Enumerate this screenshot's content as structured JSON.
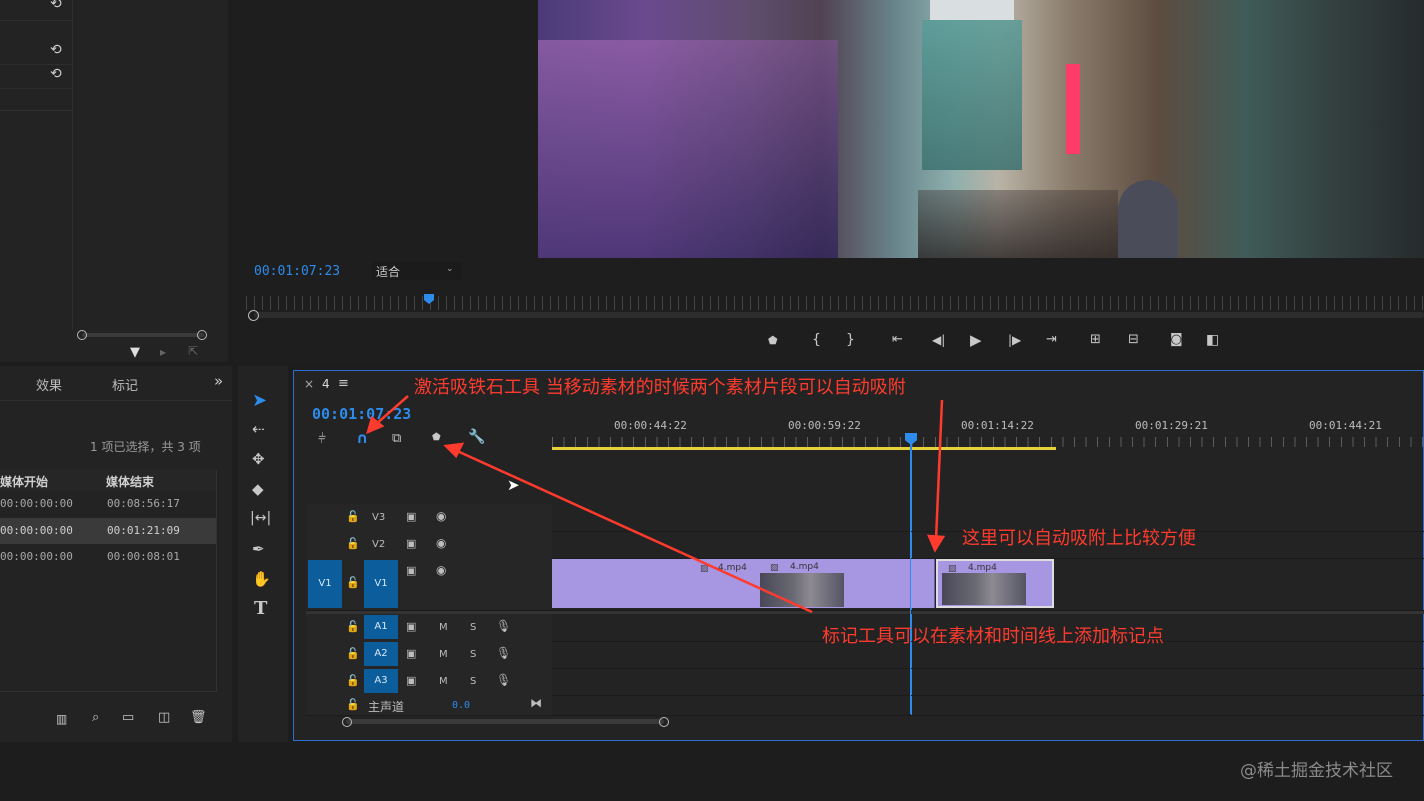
{
  "left_panel": {
    "reset_icon": "reset-icon",
    "tabs": [
      "效果",
      "标记"
    ],
    "more": "»",
    "selection_status": "1 项已选择，共 3 项",
    "columns": [
      "媒体开始",
      "媒体结束"
    ],
    "rows": [
      {
        "start": "00:00:00:00",
        "end": "00:08:56:17"
      },
      {
        "start": "00:00:00:00",
        "end": "00:01:21:09"
      },
      {
        "start": "00:00:00:00",
        "end": "00:00:08:01"
      }
    ]
  },
  "program": {
    "timecode": "00:01:07:23",
    "fit": "适合"
  },
  "timeline": {
    "close": "×",
    "sequence_name": "4",
    "menu": "≡",
    "timecode": "00:01:07:23",
    "ruler_labels": [
      "00:00:44:22",
      "00:00:59:22",
      "00:01:14:22",
      "00:01:29:21",
      "00:01:44:21"
    ],
    "tracks": {
      "v3": "V3",
      "v2": "V2",
      "v1": "V1",
      "v1_src": "V1",
      "a1": "A1",
      "a2": "A2",
      "a3": "A3",
      "m": "M",
      "s": "S",
      "master_label": "主声道",
      "master_value": "0.0"
    },
    "clips": [
      "4.mp4",
      "4.mp4",
      "4.mp4"
    ]
  },
  "annotations": {
    "magnet": "激活吸铁石工具 当移动素材的时候两个素材片段可以自动吸附",
    "snap": "这里可以自动吸附上比较方便",
    "marker": "标记工具可以在素材和时间线上添加标记点"
  },
  "watermark": "@稀土掘金技术社区",
  "colors": {
    "accent": "#2d8ceb",
    "annotation": "#ff3b2e",
    "clip": "#a797e3",
    "track_target": "#0b5d9c"
  }
}
